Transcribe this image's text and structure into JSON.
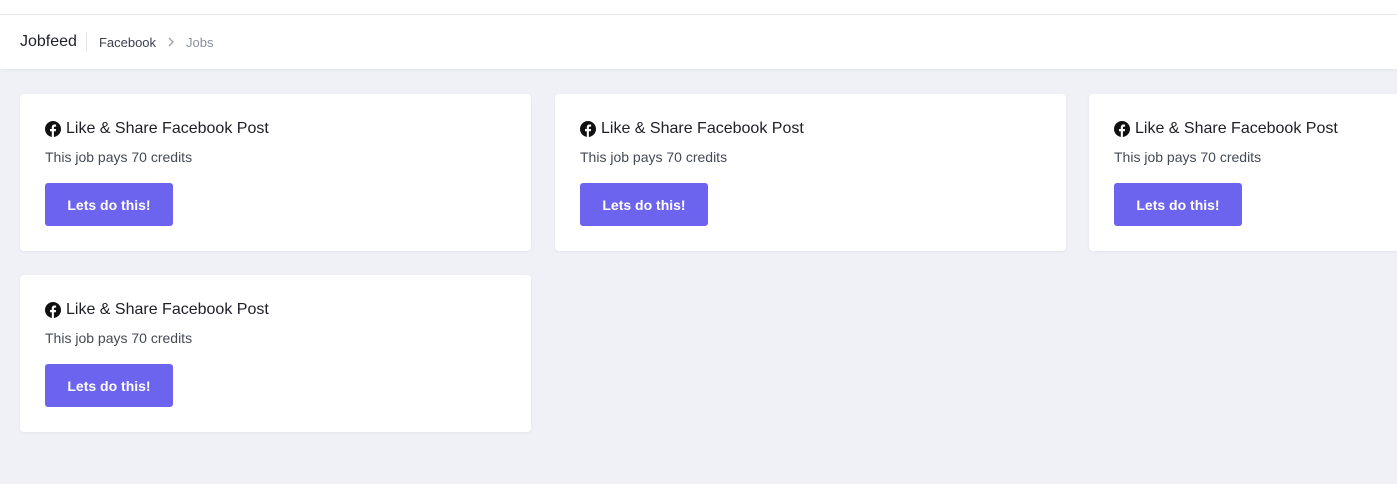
{
  "header": {
    "title": "Jobfeed",
    "breadcrumb": {
      "link": "Facebook",
      "separator_icon": "chevron-right-icon",
      "current": "Jobs"
    }
  },
  "jobs": [
    {
      "icon": "facebook-icon",
      "title": "Like & Share Facebook Post",
      "description": "This job pays 70 credits",
      "button_label": "Lets do this!"
    },
    {
      "icon": "facebook-icon",
      "title": "Like & Share Facebook Post",
      "description": "This job pays 70 credits",
      "button_label": "Lets do this!"
    },
    {
      "icon": "facebook-icon",
      "title": "Like & Share Facebook Post",
      "description": "This job pays 70 credits",
      "button_label": "Lets do this!"
    },
    {
      "icon": "facebook-icon",
      "title": "Like & Share Facebook Post",
      "description": "This job pays 70 credits",
      "button_label": "Lets do this!"
    }
  ],
  "colors": {
    "accent": "#6c63ee",
    "background": "#f0f1f7",
    "card": "#ffffff"
  }
}
